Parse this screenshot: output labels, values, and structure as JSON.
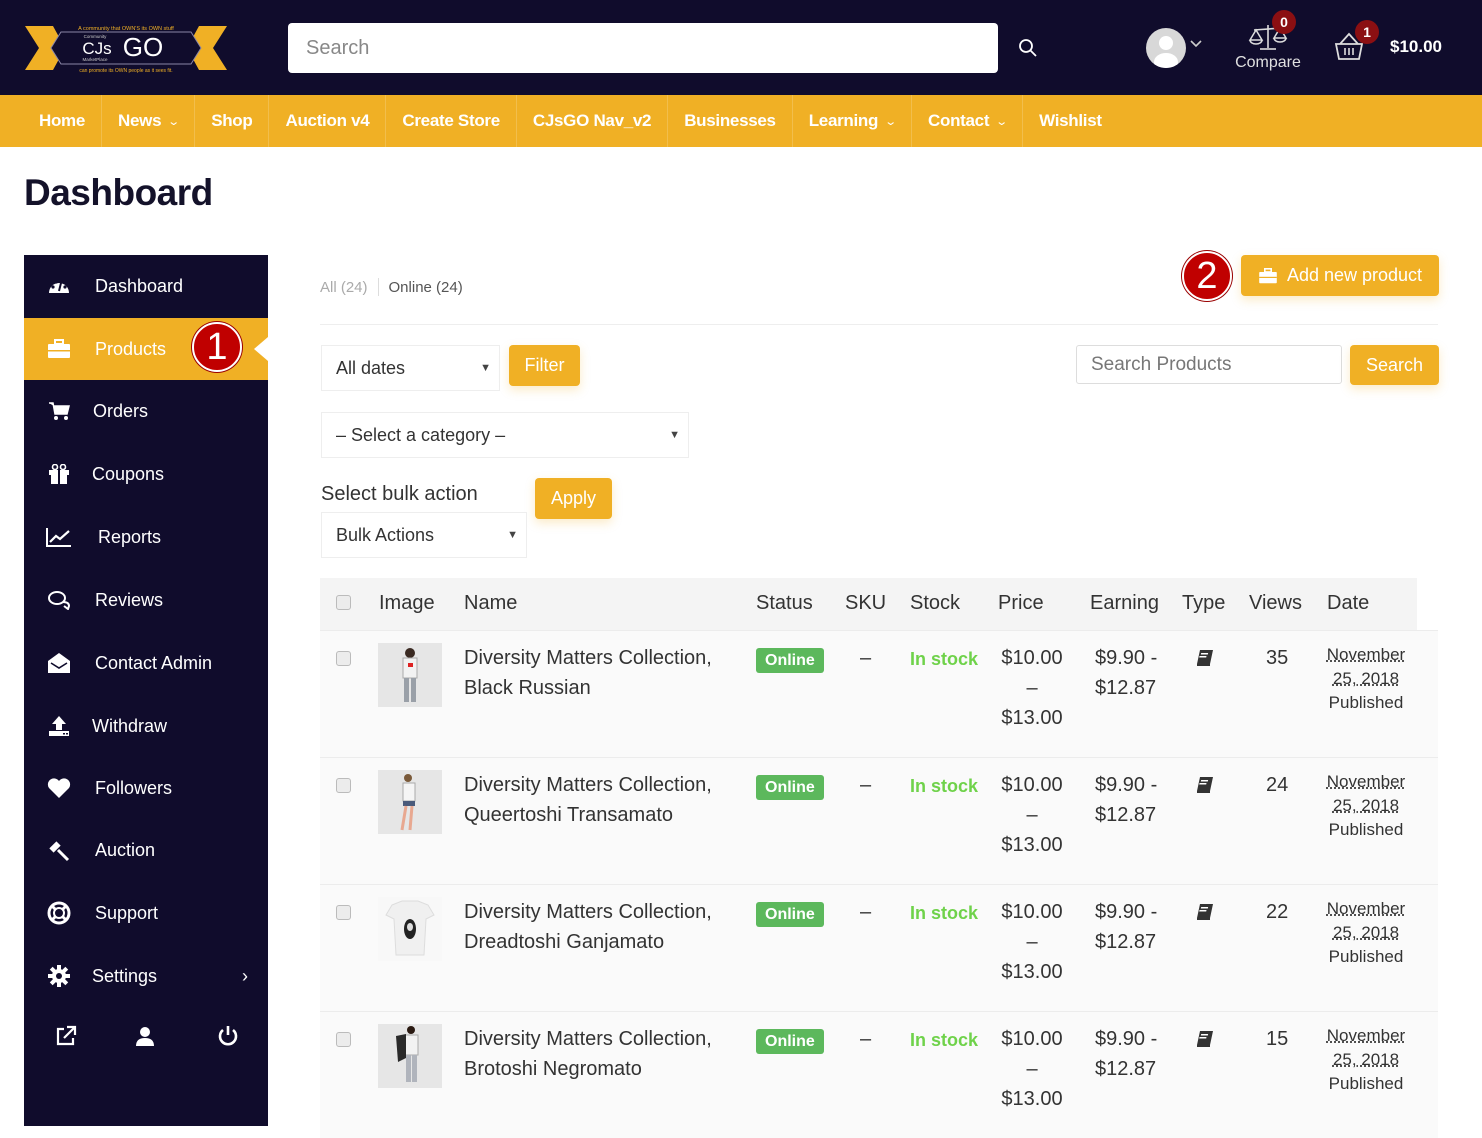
{
  "header": {
    "logo": {
      "tagline_top": "A community that OWN'S its OWN stuff",
      "small_top": "Community",
      "brand_left": "CJs",
      "brand_right": "GO",
      "small_bottom": "MarketPlace",
      "tagline_bottom": "can promote its OWN people as it sees fit."
    },
    "search_placeholder": "Search",
    "compare_label": "Compare",
    "compare_count": "0",
    "cart_count": "1",
    "cart_total": "$10.00"
  },
  "nav": {
    "items": [
      {
        "label": "Home",
        "dropdown": false
      },
      {
        "label": "News",
        "dropdown": true
      },
      {
        "label": "Shop",
        "dropdown": false
      },
      {
        "label": "Auction v4",
        "dropdown": false
      },
      {
        "label": "Create Store",
        "dropdown": false
      },
      {
        "label": "CJsGO Nav_v2",
        "dropdown": false
      },
      {
        "label": "Businesses",
        "dropdown": false
      },
      {
        "label": "Learning",
        "dropdown": true
      },
      {
        "label": "Contact",
        "dropdown": true
      },
      {
        "label": "Wishlist",
        "dropdown": false
      }
    ]
  },
  "page_title": "Dashboard",
  "sidebar": {
    "items": [
      {
        "label": "Dashboard",
        "icon": "tachometer-icon"
      },
      {
        "label": "Products",
        "icon": "briefcase-icon",
        "active": true
      },
      {
        "label": "Orders",
        "icon": "cart-icon"
      },
      {
        "label": "Coupons",
        "icon": "gift-icon"
      },
      {
        "label": "Reports",
        "icon": "line-chart-icon"
      },
      {
        "label": "Reviews",
        "icon": "comments-icon"
      },
      {
        "label": "Contact Admin",
        "icon": "envelope-open-icon"
      },
      {
        "label": "Withdraw",
        "icon": "upload-icon"
      },
      {
        "label": "Followers",
        "icon": "heart-icon"
      },
      {
        "label": "Auction",
        "icon": "gavel-icon"
      },
      {
        "label": "Support",
        "icon": "life-ring-icon"
      },
      {
        "label": "Settings",
        "icon": "gear-icon",
        "submenu": true
      }
    ],
    "settings_chevron": "›"
  },
  "markers": {
    "one": "1",
    "two": "2"
  },
  "content": {
    "filters": {
      "all": "All (24)",
      "online": "Online (24)"
    },
    "add_new_product": "Add new product",
    "dates_select": "All dates",
    "filter_button": "Filter",
    "category_select": "– Select a category –",
    "search_products_placeholder": "Search Products",
    "search_button": "Search",
    "bulk_label": "Select bulk action",
    "bulk_select": "Bulk Actions",
    "apply_button": "Apply"
  },
  "table": {
    "headers": [
      "Image",
      "Name",
      "Status",
      "SKU",
      "Stock",
      "Price",
      "Earning",
      "Type",
      "Views",
      "Date"
    ],
    "rows": [
      {
        "name_line1": "Diversity Matters Collection,",
        "name_line2": "Black Russian",
        "status": "Online",
        "sku": "–",
        "stock": "In stock",
        "price_min": "$10.00",
        "price_sep": "–",
        "price_max": "$13.00",
        "earning_line1": "$9.90 -",
        "earning_line2": "$12.87",
        "type_icon": "book-icon",
        "views": "35",
        "date_line1": "November",
        "date_line2": "25, 2018",
        "date_status": "Published"
      },
      {
        "name_line1": "Diversity Matters Collection,",
        "name_line2": "Queertoshi Transamato",
        "status": "Online",
        "sku": "–",
        "stock": "In stock",
        "price_min": "$10.00",
        "price_sep": "–",
        "price_max": "$13.00",
        "earning_line1": "$9.90 -",
        "earning_line2": "$12.87",
        "type_icon": "book-icon",
        "views": "24",
        "date_line1": "November",
        "date_line2": "25, 2018",
        "date_status": "Published"
      },
      {
        "name_line1": "Diversity Matters Collection,",
        "name_line2": "Dreadtoshi Ganjamato",
        "status": "Online",
        "sku": "–",
        "stock": "In stock",
        "price_min": "$10.00",
        "price_sep": "–",
        "price_max": "$13.00",
        "earning_line1": "$9.90 -",
        "earning_line2": "$12.87",
        "type_icon": "book-icon",
        "views": "22",
        "date_line1": "November",
        "date_line2": "25, 2018",
        "date_status": "Published"
      },
      {
        "name_line1": "Diversity Matters Collection,",
        "name_line2": "Brotoshi Negromato",
        "status": "Online",
        "sku": "–",
        "stock": "In stock",
        "price_min": "$10.00",
        "price_sep": "–",
        "price_max": "$13.00",
        "earning_line1": "$9.90 -",
        "earning_line2": "$12.87",
        "type_icon": "book-icon",
        "views": "15",
        "date_line1": "November",
        "date_line2": "25, 2018",
        "date_status": "Published"
      }
    ]
  },
  "colors": {
    "header_bg": "#100c2c",
    "accent": "#f0b025",
    "marker": "#c00000",
    "online_badge": "#5cb85c",
    "in_stock": "#6fd24a",
    "badge_red": "#8b0f12"
  }
}
